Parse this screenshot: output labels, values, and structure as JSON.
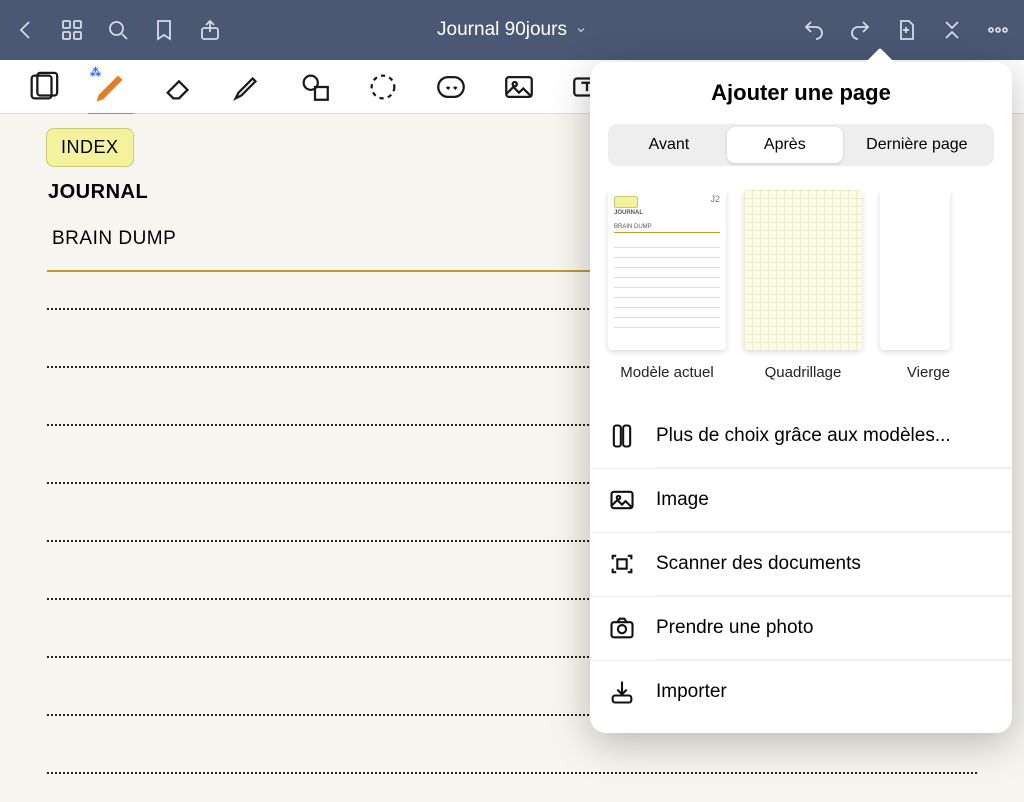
{
  "header": {
    "title": "Journal 90jours"
  },
  "page": {
    "index_tab": "INDEX",
    "journal_label": "JOURNAL",
    "brain_dump_label": "BRAIN DUMP",
    "template_page_badge": "J2"
  },
  "popover": {
    "title": "Ajouter une page",
    "segments": {
      "before": "Avant",
      "after": "Après",
      "last": "Dernière page"
    },
    "active_segment": "after",
    "templates": {
      "current": "Modèle actuel",
      "grid": "Quadrillage",
      "blank": "Vierge"
    },
    "actions": {
      "more_templates": "Plus de choix grâce aux modèles...",
      "image": "Image",
      "scan": "Scanner des documents",
      "photo": "Prendre une photo",
      "import": "Importer"
    }
  }
}
